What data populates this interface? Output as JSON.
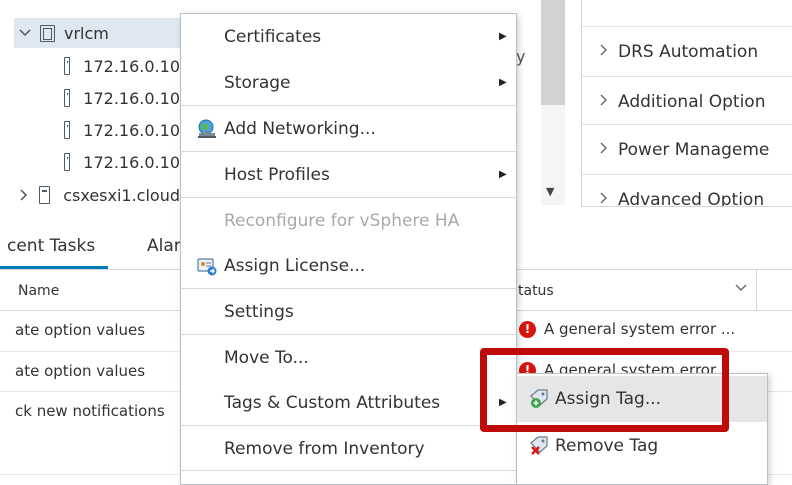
{
  "inventory_tree": {
    "parent": {
      "label": "vrlcm",
      "expanded": true
    },
    "children": [
      "172.16.0.10",
      "172.16.0.10",
      "172.16.0.10",
      "172.16.0.10"
    ],
    "sibling": {
      "label": "csxesxi1.cloud"
    }
  },
  "partial_text": "y",
  "settings_panel": {
    "items": [
      "DRS Automation",
      "Additional Option",
      "Power Manageme",
      "Advanced Option"
    ]
  },
  "recent_tasks": {
    "tabs": [
      {
        "label": "cent Tasks",
        "active": true
      },
      {
        "label": "Alar",
        "active": false
      }
    ],
    "columns": {
      "name": "Name",
      "status": "tatus"
    },
    "rows": [
      {
        "name": "ate option values",
        "status": "A general system error ..."
      },
      {
        "name": "ate option values",
        "status": "A general system error"
      },
      {
        "name": "ck new notifications",
        "status": ""
      }
    ],
    "status_color": "#d7150e"
  },
  "context_menu": {
    "items": [
      {
        "label": "Certificates",
        "submenu": true,
        "disabled": false,
        "icon": ""
      },
      {
        "label": "Storage",
        "submenu": true,
        "disabled": false,
        "icon": ""
      },
      {
        "label": "Add Networking...",
        "submenu": false,
        "disabled": false,
        "icon": "network-globe-icon"
      },
      {
        "label": "Host Profiles",
        "submenu": true,
        "disabled": false,
        "icon": ""
      },
      {
        "label": "Reconfigure for vSphere HA",
        "submenu": false,
        "disabled": true,
        "icon": ""
      },
      {
        "label": "Assign License...",
        "submenu": false,
        "disabled": false,
        "icon": "license-key-icon"
      },
      {
        "label": "Settings",
        "submenu": false,
        "disabled": false,
        "icon": ""
      },
      {
        "label": "Move To...",
        "submenu": false,
        "disabled": false,
        "icon": ""
      },
      {
        "label": "Tags & Custom Attributes",
        "submenu": true,
        "disabled": false,
        "icon": ""
      },
      {
        "label": "Remove from Inventory",
        "submenu": false,
        "disabled": false,
        "icon": ""
      }
    ]
  },
  "tags_submenu": {
    "items": [
      {
        "label": "Assign Tag...",
        "hovered": true,
        "icon": "assign-tag-icon"
      },
      {
        "label": "Remove Tag",
        "hovered": false,
        "icon": "remove-tag-icon"
      }
    ]
  },
  "colors": {
    "accent": "#0079b8",
    "highlight": "#bf0a0a",
    "error": "#d7150e",
    "selected_row": "#dfe7f0"
  }
}
